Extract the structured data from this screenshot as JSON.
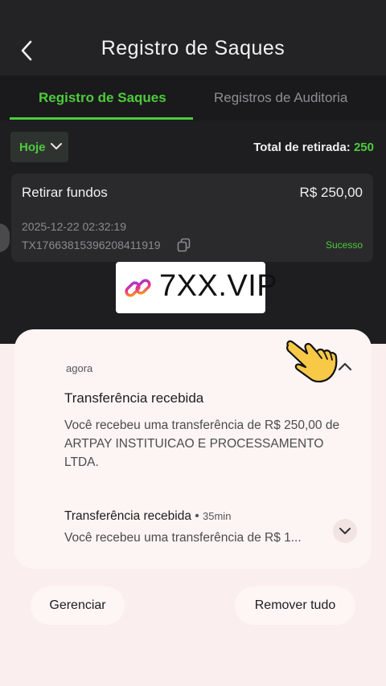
{
  "header": {
    "title": "Registro de Saques",
    "back_icon": "chevron-left-icon"
  },
  "tabs": [
    {
      "label": "Registro de Saques",
      "active": true
    },
    {
      "label": "Registros de Auditoria",
      "active": false
    }
  ],
  "filter": {
    "selected": "Hoje"
  },
  "summary": {
    "label": "Total de retirada:",
    "value": "250"
  },
  "withdrawals": [
    {
      "type": "Retirar fundos",
      "amount": "R$ 250,00",
      "datetime": "2025-12-22 02:32:19",
      "tx_id": "TX17663815396208411919",
      "status": "Sucesso"
    }
  ],
  "watermark": {
    "text": "7XX.VIP"
  },
  "notifications": [
    {
      "time": "agora",
      "title": "Transferência recebida",
      "body": "Você recebeu uma transferência de R$ 250,00 de ARTPAY INSTITUICAO E PROCESSAMENTO LTDA."
    },
    {
      "title": "Transferência recebida",
      "separator": "•",
      "time": "35min",
      "body": "Você recebeu uma transferência de R$ 1..."
    }
  ],
  "actions": {
    "manage": "Gerenciar",
    "clear_all": "Remover tudo"
  },
  "colors": {
    "accent": "#4ecb3c",
    "dark_bg": "#232325",
    "panel_bg": "#fbeeee"
  }
}
